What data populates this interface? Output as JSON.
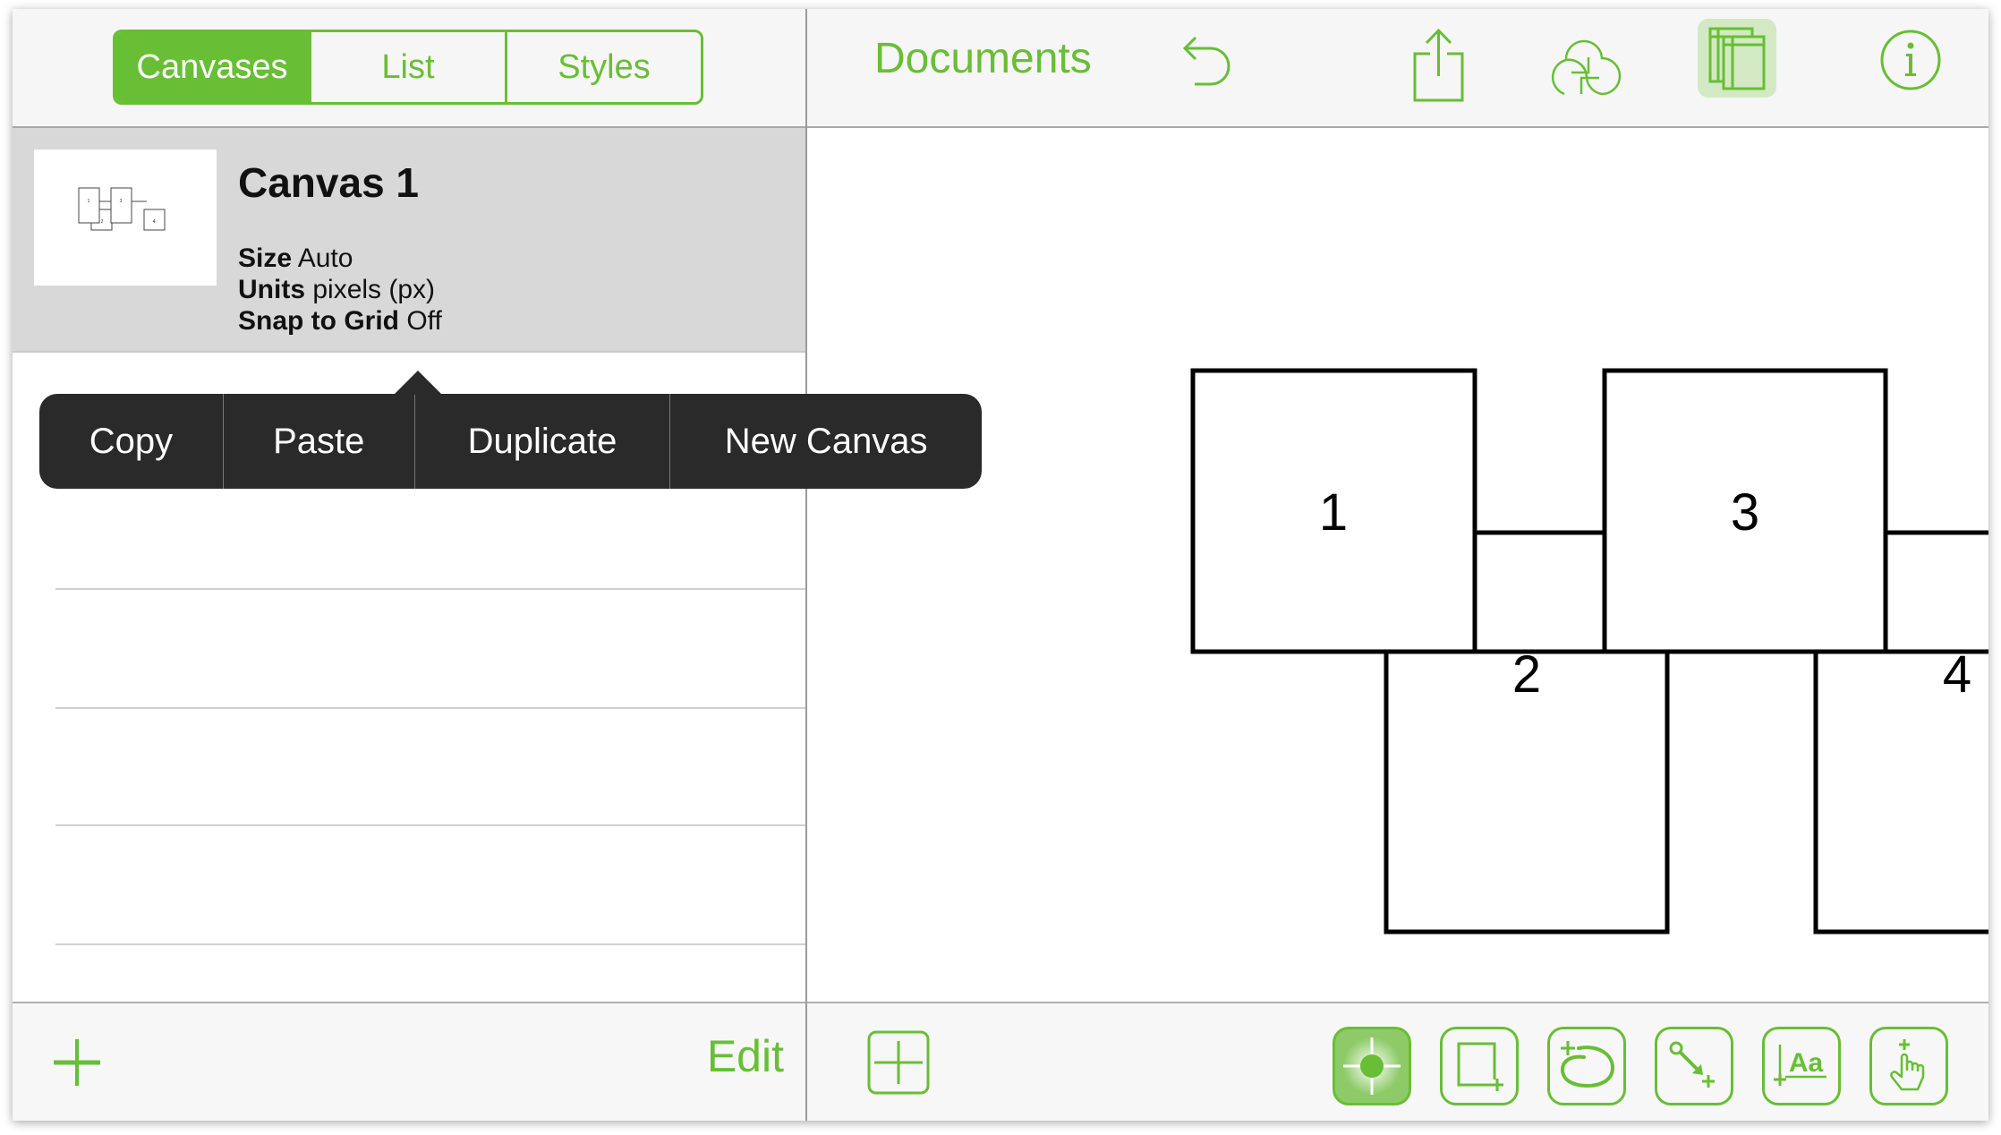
{
  "sidebar": {
    "tabs": [
      {
        "label": "Canvases",
        "active": true
      },
      {
        "label": "List",
        "active": false
      },
      {
        "label": "Styles",
        "active": false
      }
    ],
    "canvases": [
      {
        "title": "Canvas 1",
        "properties": [
          {
            "key": "Size",
            "value": "Auto"
          },
          {
            "key": "Units",
            "value": "pixels (px)"
          },
          {
            "key": "Snap to Grid",
            "value": "Off"
          }
        ],
        "thumbnail_labels": [
          "1",
          "2",
          "3",
          "4"
        ]
      }
    ],
    "edit_label": "Edit",
    "add_icon": "plus-icon"
  },
  "context_menu": {
    "items": [
      "Copy",
      "Paste",
      "Duplicate",
      "New Canvas"
    ]
  },
  "toolbar": {
    "documents_label": "Documents",
    "icons": [
      "undo-icon",
      "share-icon",
      "cloud-sync-icon",
      "canvases-sidebar-icon",
      "info-icon"
    ]
  },
  "canvas": {
    "shapes": [
      {
        "label": "1"
      },
      {
        "label": "2"
      },
      {
        "label": "3"
      },
      {
        "label": "4"
      }
    ]
  },
  "tools": {
    "items": [
      {
        "name": "selection-tool",
        "active": true
      },
      {
        "name": "shape-tool",
        "active": false
      },
      {
        "name": "freehand-tool",
        "active": false
      },
      {
        "name": "line-tool",
        "active": false
      },
      {
        "name": "text-tool",
        "active": false,
        "glyph": "Aa"
      },
      {
        "name": "hand-tool",
        "active": false
      }
    ]
  },
  "colors": {
    "accent": "#68be35",
    "accent_light": "#d3e9c4",
    "popover_bg": "#2a2a2a",
    "selected_row": "#d8d8d8"
  }
}
